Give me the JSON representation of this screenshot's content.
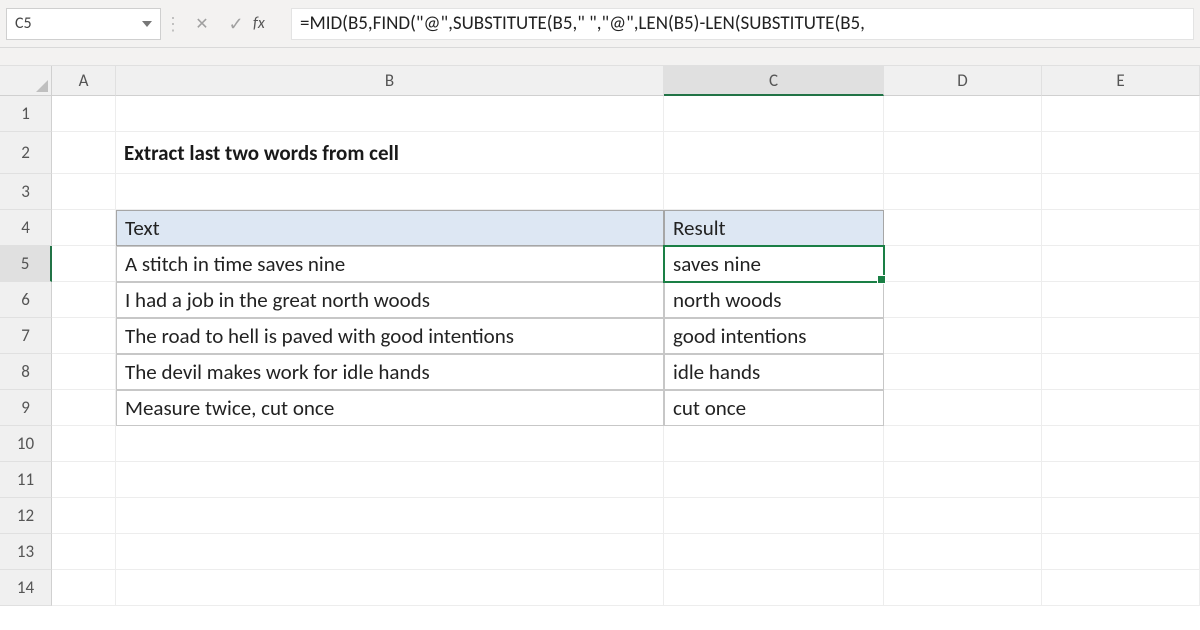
{
  "formula_bar": {
    "name_box": "C5",
    "cancel_icon": "✕",
    "enter_icon": "✓",
    "fx_label": "fx",
    "formula": "=MID(B5,FIND(\"@\",SUBSTITUTE(B5,\" \",\"@\",LEN(B5)-LEN(SUBSTITUTE(B5,"
  },
  "columns": {
    "A": "A",
    "B": "B",
    "C": "C",
    "D": "D",
    "E": "E"
  },
  "rows": [
    "1",
    "2",
    "3",
    "4",
    "5",
    "6",
    "7",
    "8",
    "9",
    "10",
    "11",
    "12",
    "13",
    "14"
  ],
  "title": "Extract last two words from cell",
  "table": {
    "headers": {
      "text": "Text",
      "result": "Result"
    },
    "rows": [
      {
        "text": "A stitch in time saves nine",
        "result": "saves nine"
      },
      {
        "text": "I had a job in the great north woods",
        "result": "north woods"
      },
      {
        "text": "The road to hell is paved with good intentions",
        "result": "good intentions"
      },
      {
        "text": "The devil makes work for idle hands",
        "result": "idle hands"
      },
      {
        "text": "Measure twice, cut once",
        "result": "cut once"
      }
    ]
  },
  "active_cell": "C5"
}
